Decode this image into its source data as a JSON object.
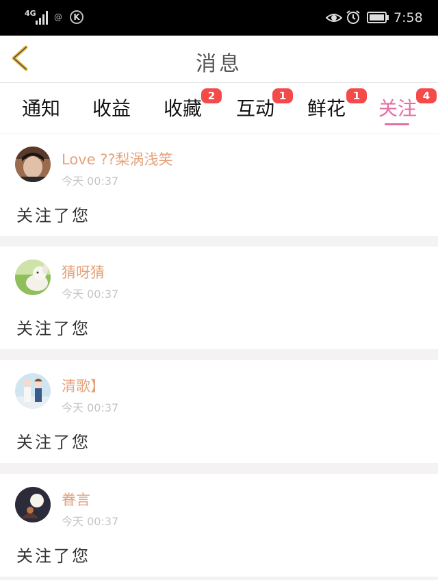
{
  "status_bar": {
    "network": "4G",
    "at_symbol": "@",
    "k_icon": "K",
    "time": "7:58"
  },
  "header": {
    "title": "消息",
    "back_icon": "chevron-left-icon"
  },
  "colors": {
    "accent": "#e76ca3",
    "badge": "#f44a4a",
    "username": "#e5a27a",
    "timestamp": "#c4c4c4"
  },
  "tabs": [
    {
      "label": "通知",
      "badge": ""
    },
    {
      "label": "收益",
      "badge": ""
    },
    {
      "label": "收藏",
      "badge": "2"
    },
    {
      "label": "互动",
      "badge": "1"
    },
    {
      "label": "鲜花",
      "badge": "1"
    },
    {
      "label": "关注",
      "badge": "4",
      "active": true
    }
  ],
  "notifications": [
    {
      "username": "Love ??梨涡浅笑",
      "time": "今天 00:37",
      "message": "关注了您",
      "avatar": "boy-portrait-avatar"
    },
    {
      "username": "猜呀猜",
      "time": "今天 00:37",
      "message": "关注了您",
      "avatar": "white-dog-avatar"
    },
    {
      "username": "清歌】",
      "time": "今天 00:37",
      "message": "关注了您",
      "avatar": "anime-couple-avatar"
    },
    {
      "username": "眷言",
      "time": "今天 00:37",
      "message": "关注了您",
      "avatar": "night-moon-avatar"
    }
  ]
}
